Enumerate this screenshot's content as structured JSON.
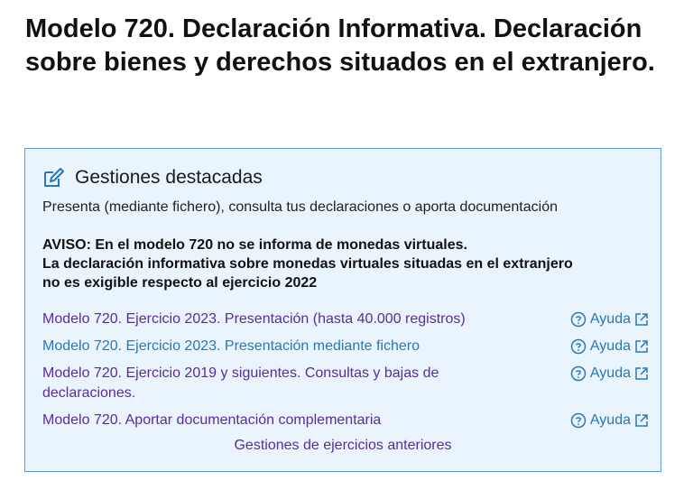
{
  "page": {
    "title": "Modelo 720. Declaración Informativa. Declaración sobre bienes y derechos situados en el extranjero."
  },
  "panel": {
    "icon": "edit-icon",
    "title": "Gestiones destacadas",
    "subtitle": "Presenta (mediante fichero), consulta tus declaraciones o aporta documentación",
    "notice_lines": [
      "AVISO: En el modelo 720 no se informa de monedas virtuales.",
      "La declaración informativa sobre monedas virtuales situadas en el extranjero",
      "no es exigible respecto al ejercicio 2022"
    ],
    "links": [
      {
        "label": "Modelo 720. Ejercicio 2023. Presentación (hasta 40.000 registros)",
        "help": "Ayuda"
      },
      {
        "label": "Modelo 720. Ejercicio 2023. Presentación mediante fichero",
        "help": "Ayuda"
      },
      {
        "label": "Modelo 720. Ejercicio 2019 y siguientes. Consultas y bajas de declaraciones.",
        "help": "Ayuda"
      },
      {
        "label": "Modelo 720. Aportar documentación complementaria",
        "help": "Ayuda"
      }
    ],
    "previous_link": "Gestiones de ejercicios anteriores"
  },
  "colors": {
    "panel_background": "#eaf4fc",
    "panel_border": "#5a9bd5",
    "link_visited": "#5b2ba0",
    "link": "#2a77b8"
  },
  "icons": {
    "help": "question-circle-icon",
    "external": "external-link-icon"
  }
}
